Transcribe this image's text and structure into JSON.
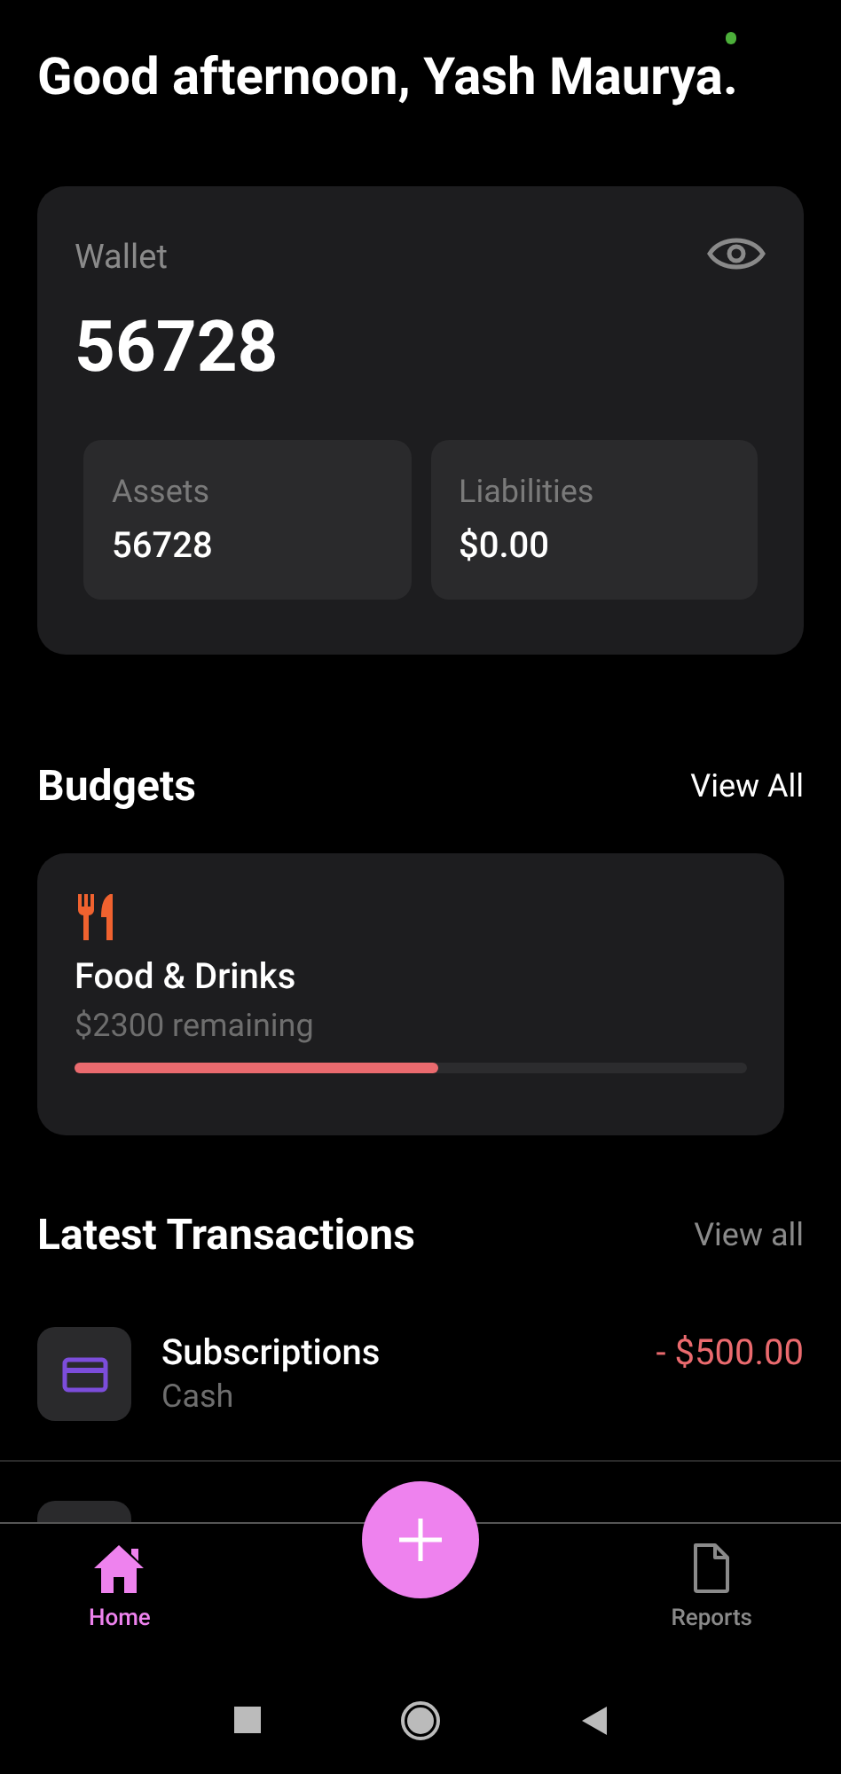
{
  "greeting": "Good afternoon, Yash Maurya.",
  "wallet": {
    "label": "Wallet",
    "amount": "56728",
    "assets": {
      "label": "Assets",
      "value": "56728"
    },
    "liabilities": {
      "label": "Liabilities",
      "value": "$0.00"
    }
  },
  "budgets": {
    "title": "Budgets",
    "view_all": "View All",
    "items": [
      {
        "kind": "food",
        "name": "Food & Drinks",
        "remaining": "$2300 remaining",
        "level": 0.54
      }
    ]
  },
  "transactions": {
    "title": "Latest Transactions",
    "view_all": "View all",
    "items": [
      {
        "kind": "card",
        "title": "Subscriptions",
        "account": "Cash",
        "amount": "- $500.00"
      }
    ]
  },
  "nav": {
    "items": [
      {
        "kind": "home",
        "label": "Home",
        "selected": true
      },
      {
        "kind": "reports",
        "label": "Reports",
        "selected": false
      }
    ]
  }
}
